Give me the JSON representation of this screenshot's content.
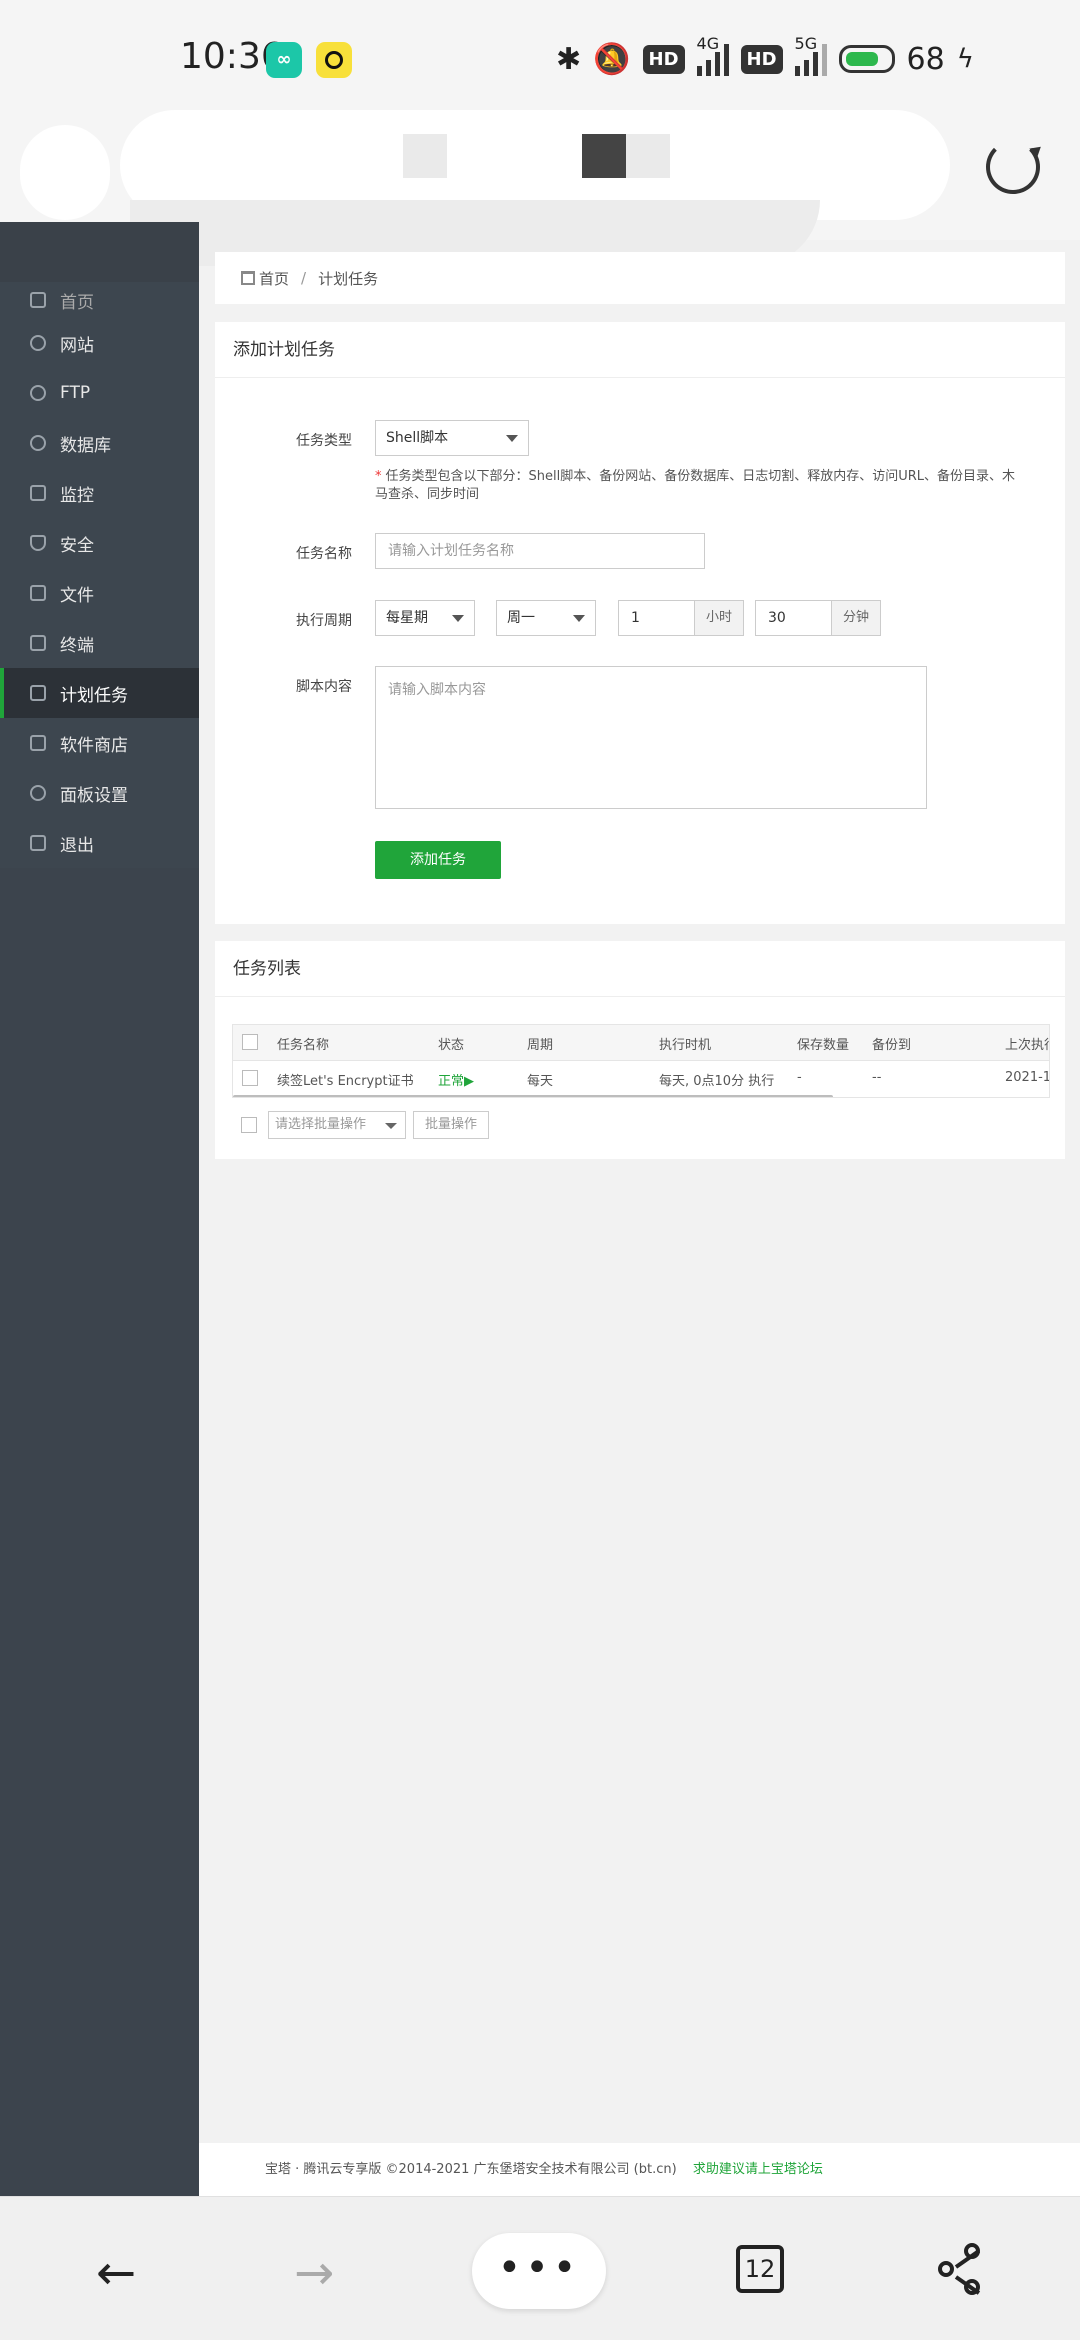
{
  "statusbar": {
    "time": "10:36",
    "app1_icon": "loop-app-icon",
    "hd1": "HD",
    "net1": "4G",
    "hd2": "HD",
    "net2": "5G",
    "battery": "68"
  },
  "breadcrumb": {
    "home": "首页",
    "current": "计划任务"
  },
  "sidebar": {
    "partial_label": "首页",
    "items": [
      {
        "label": "网站",
        "icon": "globe-icon"
      },
      {
        "label": "FTP",
        "icon": "ftp-icon"
      },
      {
        "label": "数据库",
        "icon": "database-icon"
      },
      {
        "label": "监控",
        "icon": "monitor-icon"
      },
      {
        "label": "安全",
        "icon": "shield-icon"
      },
      {
        "label": "文件",
        "icon": "folder-icon"
      },
      {
        "label": "终端",
        "icon": "terminal-icon"
      },
      {
        "label": "计划任务",
        "icon": "calendar-icon",
        "active": true
      },
      {
        "label": "软件商店",
        "icon": "grid-icon"
      },
      {
        "label": "面板设置",
        "icon": "gear-icon"
      },
      {
        "label": "退出",
        "icon": "logout-icon"
      }
    ]
  },
  "add_task": {
    "title": "添加计划任务",
    "type_label": "任务类型",
    "type_value": "Shell脚本",
    "type_hint_line1": "任务类型包含以下部分：Shell脚本、备份网站、备份数据库、日志切割、释放内存、访问URL、备份目录、木",
    "type_hint_line2": "马查杀、同步时间",
    "name_label": "任务名称",
    "name_placeholder": "请输入计划任务名称",
    "period_label": "执行周期",
    "period_value": "每星期",
    "weekday_value": "周一",
    "hour_value": "1",
    "hour_unit": "小时",
    "minute_value": "30",
    "minute_unit": "分钟",
    "script_label": "脚本内容",
    "script_placeholder": "请输入脚本内容",
    "submit_label": "添加任务"
  },
  "task_list": {
    "title": "任务列表",
    "columns": [
      "任务名称",
      "状态",
      "周期",
      "执行时机",
      "保存数量",
      "备份到",
      "上次执行"
    ],
    "rows": [
      {
        "name": "续签Let's Encrypt证书",
        "status": "正常▶",
        "period": "每天",
        "timing": "每天, 0点10分 执行",
        "keep": "-",
        "backup": "--",
        "last": "2021-1"
      }
    ],
    "batch_placeholder": "请选择批量操作",
    "batch_button": "批量操作"
  },
  "footer": {
    "copyright": "宝塔 · 腾讯云专享版 ©2014-2021 广东堡塔安全技术有限公司 (bt.cn)",
    "link": "求助建议请上宝塔论坛"
  },
  "bottomnav": {
    "menu": "•••",
    "tab_count": "12"
  }
}
